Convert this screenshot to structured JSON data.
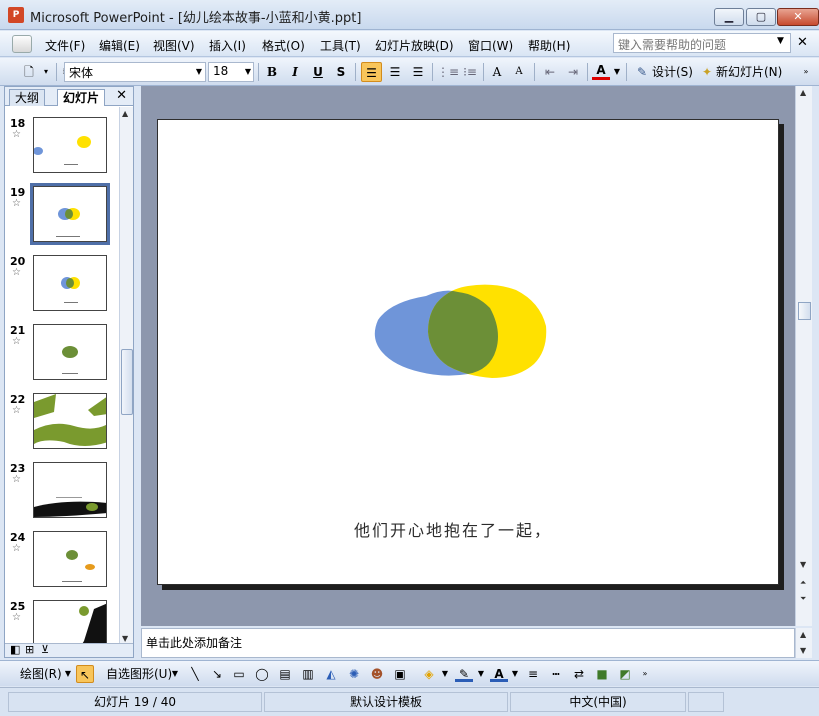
{
  "window": {
    "title": "Microsoft PowerPoint - [幼儿绘本故事-小蓝和小黄.ppt]",
    "app_icon": "powerpoint-icon",
    "controls": [
      "minimize-icon",
      "maximize-icon",
      "close-icon"
    ]
  },
  "menubar": {
    "items": [
      "文件(F)",
      "编辑(E)",
      "视图(V)",
      "插入(I)",
      "格式(O)",
      "工具(T)",
      "幻灯片放映(D)",
      "窗口(W)",
      "帮助(H)"
    ],
    "help_placeholder": "键入需要帮助的问题"
  },
  "toolbar": {
    "font_name": "宋体",
    "font_size": "18",
    "bold": "B",
    "italic": "I",
    "underline": "U",
    "shadow": "S",
    "design_label": "设计(S)",
    "new_slide_label": "新幻灯片(N)",
    "font_color_letter": "A",
    "increase_font": "A",
    "decrease_font": "A"
  },
  "left_pane": {
    "tabs": [
      "大纲",
      "幻灯片"
    ],
    "slides": [
      {
        "number": "18"
      },
      {
        "number": "19",
        "selected": true
      },
      {
        "number": "20"
      },
      {
        "number": "21"
      },
      {
        "number": "22"
      },
      {
        "number": "23"
      },
      {
        "number": "24"
      },
      {
        "number": "25"
      }
    ]
  },
  "slide": {
    "caption": "他们开心地抱在了一起，",
    "colors": {
      "blue": "#6f95d9",
      "yellow": "#ffe100",
      "green": "#6c8f37"
    }
  },
  "notes": {
    "placeholder": "单击此处添加备注"
  },
  "drawbar": {
    "draw_label": "绘图(R)",
    "autoshape_label": "自选图形(U)"
  },
  "statusbar": {
    "slide_position": "幻灯片 19 / 40",
    "template": "默认设计模板",
    "language": "中文(中国)"
  }
}
